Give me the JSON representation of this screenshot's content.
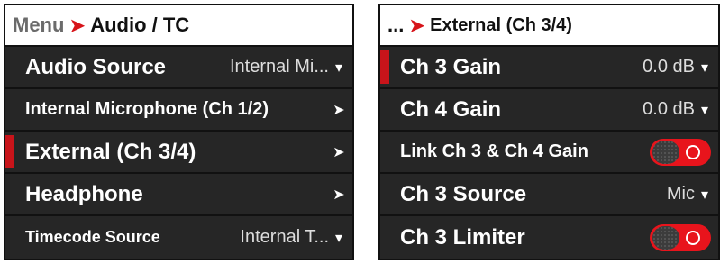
{
  "left": {
    "breadcrumb": {
      "parent": "Menu",
      "sep": "➤",
      "current": "Audio / TC"
    },
    "rows": [
      {
        "label": "Audio Source",
        "value": "Internal Mi...",
        "chevron": "▾"
      },
      {
        "label": "Internal Microphone (Ch 1/2)",
        "chevron": "➤"
      },
      {
        "label": "External (Ch 3/4)",
        "chevron": "➤"
      },
      {
        "label": "Headphone",
        "chevron": "➤"
      },
      {
        "label": "Timecode Source",
        "value": "Internal T...",
        "chevron": "▾"
      }
    ]
  },
  "right": {
    "breadcrumb": {
      "parent": "...",
      "sep": "➤",
      "current": "External (Ch 3/4)"
    },
    "rows": [
      {
        "label": "Ch 3 Gain",
        "value": "0.0 dB",
        "chevron": "▾"
      },
      {
        "label": "Ch 4 Gain",
        "value": "0.0 dB",
        "chevron": "▾"
      },
      {
        "label": "Link Ch 3 & Ch 4 Gain",
        "toggle": "on"
      },
      {
        "label": "Ch 3 Source",
        "value": "Mic",
        "chevron": "▾"
      },
      {
        "label": "Ch 3 Limiter",
        "toggle": "on"
      }
    ]
  },
  "colors": {
    "accent": "#d7141a",
    "panel": "#262626",
    "toggle_on": "#e8141c"
  },
  "icons": {
    "dropdown": "chevron-down-icon",
    "submenu": "chevron-right-icon",
    "toggle": "toggle-switch"
  }
}
